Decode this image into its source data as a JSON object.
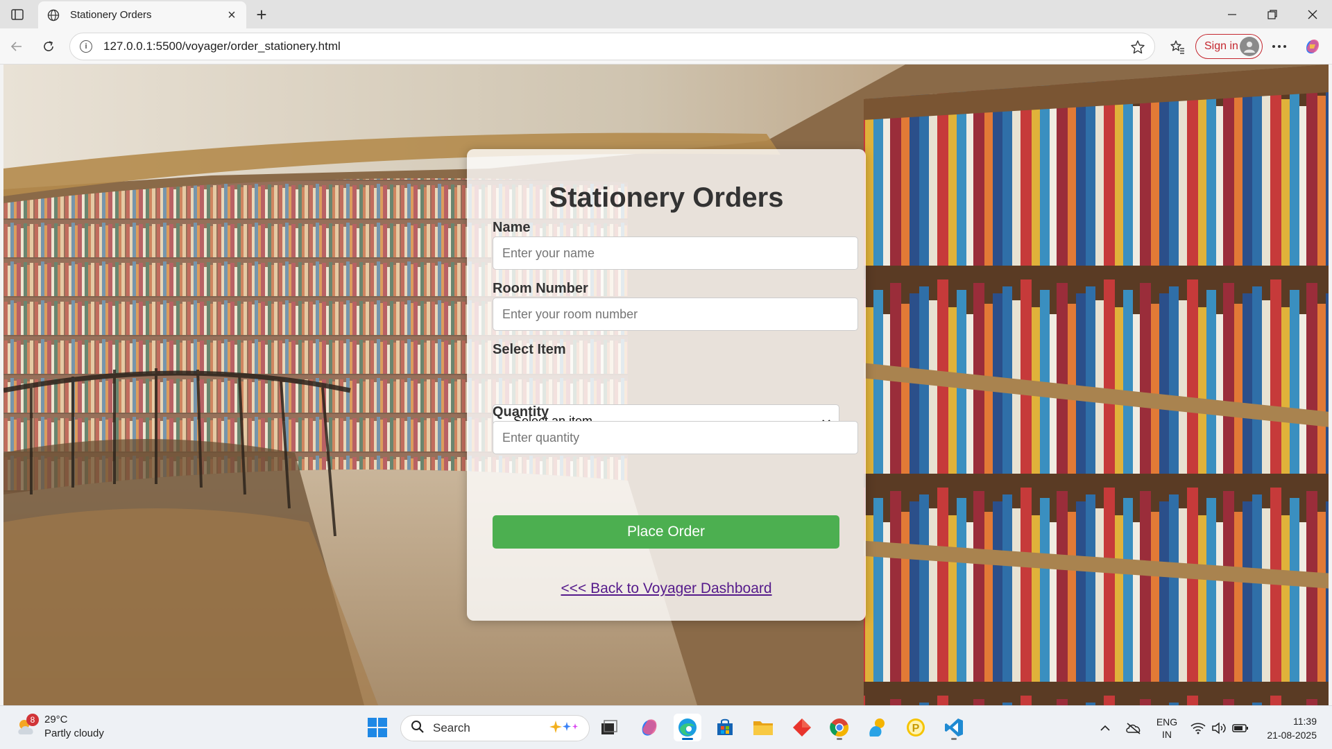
{
  "browser": {
    "tab_title": "Stationery Orders",
    "url": "127.0.0.1:5500/voyager/order_stationery.html",
    "signin_label": "Sign in"
  },
  "page": {
    "title": "Stationery Orders",
    "fields": {
      "name_label": "Name",
      "name_placeholder": "Enter your name",
      "room_label": "Room Number",
      "room_placeholder": "Enter your room number",
      "item_label": "Select Item",
      "item_selected": "--Select an item--",
      "quantity_label": "Quantity",
      "quantity_placeholder": "Enter quantity"
    },
    "submit_label": "Place Order",
    "back_link": "<<< Back to Voyager Dashboard"
  },
  "taskbar": {
    "weather_temp": "29°C",
    "weather_desc": "Partly cloudy",
    "weather_badge": "8",
    "search_label": "Search",
    "lang_line1": "ENG",
    "lang_line2": "IN",
    "time": "11:39",
    "date": "21-08-2025"
  },
  "colors": {
    "submit_button": "#4caf50",
    "link": "#551a8b",
    "signin_border": "#c4262e"
  }
}
